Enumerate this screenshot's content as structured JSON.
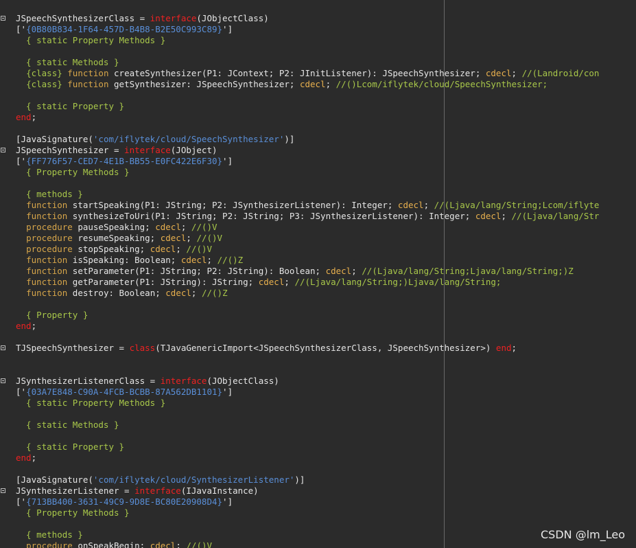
{
  "editor": {
    "lines": [
      {
        "fold": true,
        "tokens": [
          [
            "JSpeechSynthesizerClass = ",
            "plain"
          ],
          [
            "interface",
            "red"
          ],
          [
            "(JObjectClass)",
            "plain"
          ]
        ]
      },
      {
        "fold": false,
        "tokens": [
          [
            "['",
            "plain"
          ],
          [
            "{0B80B834-1F64-457D-B4B8-B2E50C993C89}",
            "str"
          ],
          [
            "']",
            "plain"
          ]
        ]
      },
      {
        "fold": false,
        "tokens": [
          [
            "  { static Property Methods }",
            "cmt"
          ]
        ]
      },
      {
        "fold": false,
        "tokens": []
      },
      {
        "fold": false,
        "tokens": [
          [
            "  { static Methods }",
            "cmt"
          ]
        ]
      },
      {
        "fold": false,
        "tokens": [
          [
            "  ",
            "plain"
          ],
          [
            "{class}",
            "cmt"
          ],
          [
            " ",
            "plain"
          ],
          [
            "function",
            "kw"
          ],
          [
            " createSynthesizer(P1: JContext; P2: JInitListener): JSpeechSynthesizer; ",
            "plain"
          ],
          [
            "cdecl",
            "kw2"
          ],
          [
            "; ",
            "plain"
          ],
          [
            "//(Landroid/con",
            "cmt"
          ]
        ]
      },
      {
        "fold": false,
        "tokens": [
          [
            "  ",
            "plain"
          ],
          [
            "{class}",
            "cmt"
          ],
          [
            " ",
            "plain"
          ],
          [
            "function",
            "kw"
          ],
          [
            " getSynthesizer: JSpeechSynthesizer; ",
            "plain"
          ],
          [
            "cdecl",
            "kw2"
          ],
          [
            "; ",
            "plain"
          ],
          [
            "//()Lcom/iflytek/cloud/SpeechSynthesizer;",
            "cmt"
          ]
        ]
      },
      {
        "fold": false,
        "tokens": []
      },
      {
        "fold": false,
        "tokens": [
          [
            "  { static Property }",
            "cmt"
          ]
        ]
      },
      {
        "fold": false,
        "tokens": [
          [
            "end",
            "red"
          ],
          [
            ";",
            "plain"
          ]
        ]
      },
      {
        "fold": false,
        "tokens": []
      },
      {
        "fold": false,
        "tokens": [
          [
            "[JavaSignature(",
            "plain"
          ],
          [
            "'com/iflytek/cloud/SpeechSynthesizer'",
            "str"
          ],
          [
            ")]",
            "plain"
          ]
        ]
      },
      {
        "fold": true,
        "tokens": [
          [
            "JSpeechSynthesizer = ",
            "plain"
          ],
          [
            "interface",
            "red"
          ],
          [
            "(JObject)",
            "plain"
          ]
        ]
      },
      {
        "fold": false,
        "tokens": [
          [
            "['",
            "plain"
          ],
          [
            "{FF776F57-CED7-4E1B-BB55-E0FC422E6F30}",
            "str"
          ],
          [
            "']",
            "plain"
          ]
        ]
      },
      {
        "fold": false,
        "tokens": [
          [
            "  { Property Methods }",
            "cmt"
          ]
        ]
      },
      {
        "fold": false,
        "tokens": []
      },
      {
        "fold": false,
        "tokens": [
          [
            "  { methods }",
            "cmt"
          ]
        ]
      },
      {
        "fold": false,
        "tokens": [
          [
            "  ",
            "plain"
          ],
          [
            "function",
            "kw"
          ],
          [
            " startSpeaking(P1: JString; P2: JSynthesizerListener): Integer; ",
            "plain"
          ],
          [
            "cdecl",
            "kw2"
          ],
          [
            "; ",
            "plain"
          ],
          [
            "//(Ljava/lang/String;Lcom/iflyte",
            "cmt"
          ]
        ]
      },
      {
        "fold": false,
        "tokens": [
          [
            "  ",
            "plain"
          ],
          [
            "function",
            "kw"
          ],
          [
            " synthesizeToUri(P1: JString; P2: JString; P3: JSynthesizerListener): Integer; ",
            "plain"
          ],
          [
            "cdecl",
            "kw2"
          ],
          [
            "; ",
            "plain"
          ],
          [
            "//(Ljava/lang/Str",
            "cmt"
          ]
        ]
      },
      {
        "fold": false,
        "tokens": [
          [
            "  ",
            "plain"
          ],
          [
            "procedure",
            "kw"
          ],
          [
            " pauseSpeaking; ",
            "plain"
          ],
          [
            "cdecl",
            "kw2"
          ],
          [
            "; ",
            "plain"
          ],
          [
            "//()V",
            "cmt"
          ]
        ]
      },
      {
        "fold": false,
        "tokens": [
          [
            "  ",
            "plain"
          ],
          [
            "procedure",
            "kw"
          ],
          [
            " resumeSpeaking; ",
            "plain"
          ],
          [
            "cdecl",
            "kw2"
          ],
          [
            "; ",
            "plain"
          ],
          [
            "//()V",
            "cmt"
          ]
        ]
      },
      {
        "fold": false,
        "tokens": [
          [
            "  ",
            "plain"
          ],
          [
            "procedure",
            "kw"
          ],
          [
            " stopSpeaking; ",
            "plain"
          ],
          [
            "cdecl",
            "kw2"
          ],
          [
            "; ",
            "plain"
          ],
          [
            "//()V",
            "cmt"
          ]
        ]
      },
      {
        "fold": false,
        "tokens": [
          [
            "  ",
            "plain"
          ],
          [
            "function",
            "kw"
          ],
          [
            " isSpeaking: Boolean; ",
            "plain"
          ],
          [
            "cdecl",
            "kw2"
          ],
          [
            "; ",
            "plain"
          ],
          [
            "//()Z",
            "cmt"
          ]
        ]
      },
      {
        "fold": false,
        "tokens": [
          [
            "  ",
            "plain"
          ],
          [
            "function",
            "kw"
          ],
          [
            " setParameter(P1: JString; P2: JString): Boolean; ",
            "plain"
          ],
          [
            "cdecl",
            "kw2"
          ],
          [
            "; ",
            "plain"
          ],
          [
            "//(Ljava/lang/String;Ljava/lang/String;)Z",
            "cmt"
          ]
        ]
      },
      {
        "fold": false,
        "tokens": [
          [
            "  ",
            "plain"
          ],
          [
            "function",
            "kw"
          ],
          [
            " getParameter(P1: JString): JString; ",
            "plain"
          ],
          [
            "cdecl",
            "kw2"
          ],
          [
            "; ",
            "plain"
          ],
          [
            "//(Ljava/lang/String;)Ljava/lang/String;",
            "cmt"
          ]
        ]
      },
      {
        "fold": false,
        "tokens": [
          [
            "  ",
            "plain"
          ],
          [
            "function",
            "kw"
          ],
          [
            " destroy: Boolean; ",
            "plain"
          ],
          [
            "cdecl",
            "kw2"
          ],
          [
            "; ",
            "plain"
          ],
          [
            "//()Z",
            "cmt"
          ]
        ]
      },
      {
        "fold": false,
        "tokens": []
      },
      {
        "fold": false,
        "tokens": [
          [
            "  { Property }",
            "cmt"
          ]
        ]
      },
      {
        "fold": false,
        "tokens": [
          [
            "end",
            "red"
          ],
          [
            ";",
            "plain"
          ]
        ]
      },
      {
        "fold": false,
        "tokens": []
      },
      {
        "fold": true,
        "tokens": [
          [
            "TJSpeechSynthesizer = ",
            "plain"
          ],
          [
            "class",
            "red"
          ],
          [
            "(TJavaGenericImport<JSpeechSynthesizerClass, JSpeechSynthesizer>) ",
            "plain"
          ],
          [
            "end",
            "red"
          ],
          [
            ";",
            "plain"
          ]
        ]
      },
      {
        "fold": false,
        "tokens": []
      },
      {
        "fold": false,
        "tokens": []
      },
      {
        "fold": true,
        "tokens": [
          [
            "JSynthesizerListenerClass = ",
            "plain"
          ],
          [
            "interface",
            "red"
          ],
          [
            "(JObjectClass)",
            "plain"
          ]
        ]
      },
      {
        "fold": false,
        "tokens": [
          [
            "['",
            "plain"
          ],
          [
            "{03A7E848-C90A-4FCB-BCBB-87A562DB1101}",
            "str"
          ],
          [
            "']",
            "plain"
          ]
        ]
      },
      {
        "fold": false,
        "tokens": [
          [
            "  { static Property Methods }",
            "cmt"
          ]
        ]
      },
      {
        "fold": false,
        "tokens": []
      },
      {
        "fold": false,
        "tokens": [
          [
            "  { static Methods }",
            "cmt"
          ]
        ]
      },
      {
        "fold": false,
        "tokens": []
      },
      {
        "fold": false,
        "tokens": [
          [
            "  { static Property }",
            "cmt"
          ]
        ]
      },
      {
        "fold": false,
        "tokens": [
          [
            "end",
            "red"
          ],
          [
            ";",
            "plain"
          ]
        ]
      },
      {
        "fold": false,
        "tokens": []
      },
      {
        "fold": false,
        "tokens": [
          [
            "[JavaSignature(",
            "plain"
          ],
          [
            "'com/iflytek/cloud/SynthesizerListener'",
            "str"
          ],
          [
            ")]",
            "plain"
          ]
        ]
      },
      {
        "fold": true,
        "tokens": [
          [
            "JSynthesizerListener = ",
            "plain"
          ],
          [
            "interface",
            "red"
          ],
          [
            "(IJavaInstance)",
            "plain"
          ]
        ]
      },
      {
        "fold": false,
        "tokens": [
          [
            "['",
            "plain"
          ],
          [
            "{713BB400-3631-49C9-9D8E-BC80E20908D4}",
            "str"
          ],
          [
            "']",
            "plain"
          ]
        ]
      },
      {
        "fold": false,
        "tokens": [
          [
            "  { Property Methods }",
            "cmt"
          ]
        ]
      },
      {
        "fold": false,
        "tokens": []
      },
      {
        "fold": false,
        "tokens": [
          [
            "  { methods }",
            "cmt"
          ]
        ]
      },
      {
        "fold": false,
        "tokens": [
          [
            "  ",
            "plain"
          ],
          [
            "procedure",
            "kw"
          ],
          [
            " onSpeakBegin; ",
            "plain"
          ],
          [
            "cdecl",
            "kw2"
          ],
          [
            "; ",
            "plain"
          ],
          [
            "//()V",
            "cmt"
          ]
        ]
      }
    ]
  },
  "watermark": {
    "text": "CSDN @lm_Leo"
  },
  "colors": {
    "background": "#2b2b2b",
    "identifier": "#e6e6e6",
    "keyword": "#d7a64a",
    "reserved_red": "#ee2222",
    "string": "#5a8fd8",
    "comment": "#a9c84a",
    "margin_line": "#6a6a6a"
  }
}
